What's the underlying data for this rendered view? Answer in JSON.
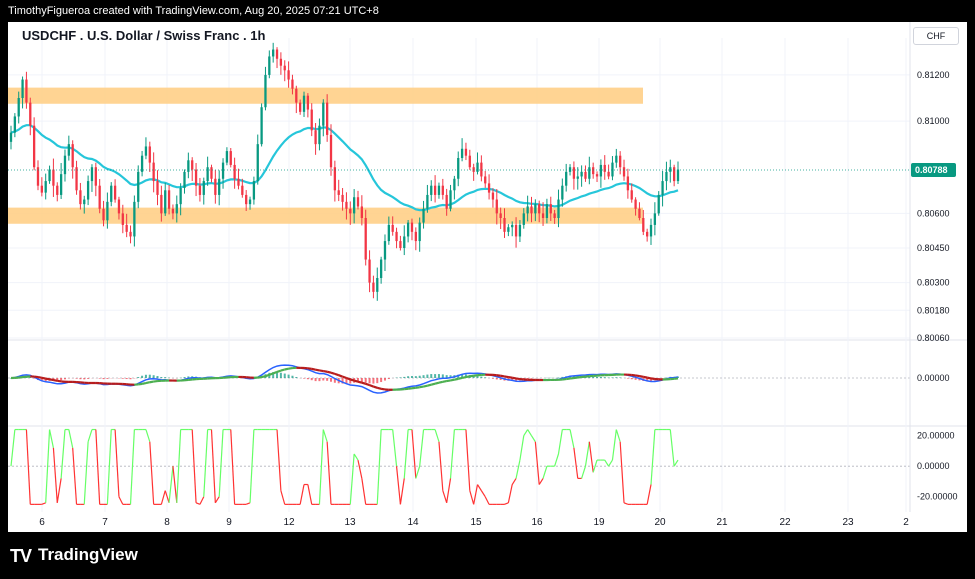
{
  "header": {
    "attribution": "TimothyFigueroa created with TradingView.com, Aug 20, 2025 07:21 UTC+8"
  },
  "chart_title": "USDCHF . U.S. Dollar / Swiss Franc . 1h",
  "currency_label": "CHF",
  "footer": {
    "logo_mark": "TV",
    "brand": "TradingView"
  },
  "colors": {
    "candle_up": "#089981",
    "candle_down": "#f23645",
    "ma_line": "#26c6da",
    "zone": "#ffcc80",
    "fast_line": "#2962ff",
    "slow_line_up": "#4caf50",
    "slow_line_down": "#b71c1c",
    "osc_up": "#66ff66",
    "osc_down": "#ff3333"
  },
  "chart_data": [
    {
      "type": "candlestick",
      "panel": "price",
      "x_tick_labels": [
        "6",
        "7",
        "8",
        "9",
        "12",
        "13",
        "14",
        "15",
        "16",
        "19",
        "20",
        "21",
        "22",
        "23",
        "2"
      ],
      "y_tick_labels": [
        "0.81200",
        "0.81000",
        "0.80600",
        "0.80450",
        "0.80300",
        "0.80180",
        "0.80060"
      ],
      "y_ticks": [
        0.812,
        0.81,
        0.806,
        0.8045,
        0.803,
        0.8018,
        0.8006
      ],
      "ylim": [
        0.8006,
        0.8136
      ],
      "last_price_label": "0.80788",
      "last_price": 0.80788,
      "resistance_zone": [
        0.81075,
        0.81145
      ],
      "support_zone": [
        0.80555,
        0.80625
      ],
      "close": [
        0.8095,
        0.8102,
        0.811,
        0.8118,
        0.8108,
        0.8098,
        0.808,
        0.8072,
        0.8069,
        0.8074,
        0.8079,
        0.8072,
        0.8068,
        0.8077,
        0.8085,
        0.809,
        0.808,
        0.807,
        0.8064,
        0.8066,
        0.8074,
        0.808,
        0.8072,
        0.8062,
        0.8057,
        0.8065,
        0.8072,
        0.8066,
        0.806,
        0.8055,
        0.8052,
        0.805,
        0.8065,
        0.8078,
        0.8085,
        0.8089,
        0.8082,
        0.8074,
        0.8068,
        0.806,
        0.807,
        0.8062,
        0.806,
        0.8064,
        0.8071,
        0.8078,
        0.8083,
        0.8079,
        0.8072,
        0.8068,
        0.8074,
        0.808,
        0.8075,
        0.8068,
        0.8075,
        0.8082,
        0.8087,
        0.8081,
        0.8075,
        0.8072,
        0.8068,
        0.8064,
        0.8066,
        0.8074,
        0.809,
        0.8106,
        0.812,
        0.8128,
        0.8131,
        0.8127,
        0.8124,
        0.8122,
        0.8118,
        0.8114,
        0.8108,
        0.8104,
        0.8111,
        0.8105,
        0.8096,
        0.809,
        0.8098,
        0.8108,
        0.8094,
        0.808,
        0.807,
        0.8068,
        0.8065,
        0.8062,
        0.806,
        0.8067,
        0.8063,
        0.8058,
        0.804,
        0.803,
        0.8026,
        0.8032,
        0.804,
        0.8048,
        0.8055,
        0.8052,
        0.8048,
        0.8045,
        0.805,
        0.8056,
        0.8052,
        0.8048,
        0.8056,
        0.8062,
        0.8068,
        0.8072,
        0.8068,
        0.8072,
        0.8068,
        0.8062,
        0.807,
        0.8075,
        0.8084,
        0.8088,
        0.8085,
        0.808,
        0.8078,
        0.8082,
        0.8076,
        0.8073,
        0.8069,
        0.8066,
        0.806,
        0.8058,
        0.8052,
        0.8054,
        0.8055,
        0.805,
        0.8055,
        0.806,
        0.8063,
        0.806,
        0.8064,
        0.806,
        0.8058,
        0.8064,
        0.806,
        0.8058,
        0.8066,
        0.8072,
        0.8078,
        0.808,
        0.8075,
        0.8076,
        0.8078,
        0.8075,
        0.808,
        0.8077,
        0.8076,
        0.8081,
        0.8078,
        0.8076,
        0.8082,
        0.8085,
        0.808,
        0.8076,
        0.807,
        0.8066,
        0.8062,
        0.8058,
        0.8052,
        0.805,
        0.8055,
        0.806,
        0.8068,
        0.8074,
        0.8078,
        0.808,
        0.8074,
        0.8079
      ]
    },
    {
      "type": "line",
      "panel": "macd",
      "y_tick_labels": [
        "0.00000"
      ],
      "zero_line": 0
    },
    {
      "type": "line",
      "panel": "oscillator",
      "y_tick_labels": [
        "20.00000",
        "0.00000",
        "-20.00000"
      ],
      "y_ticks": [
        20,
        0,
        -20
      ],
      "ylim": [
        -30,
        25
      ]
    }
  ]
}
